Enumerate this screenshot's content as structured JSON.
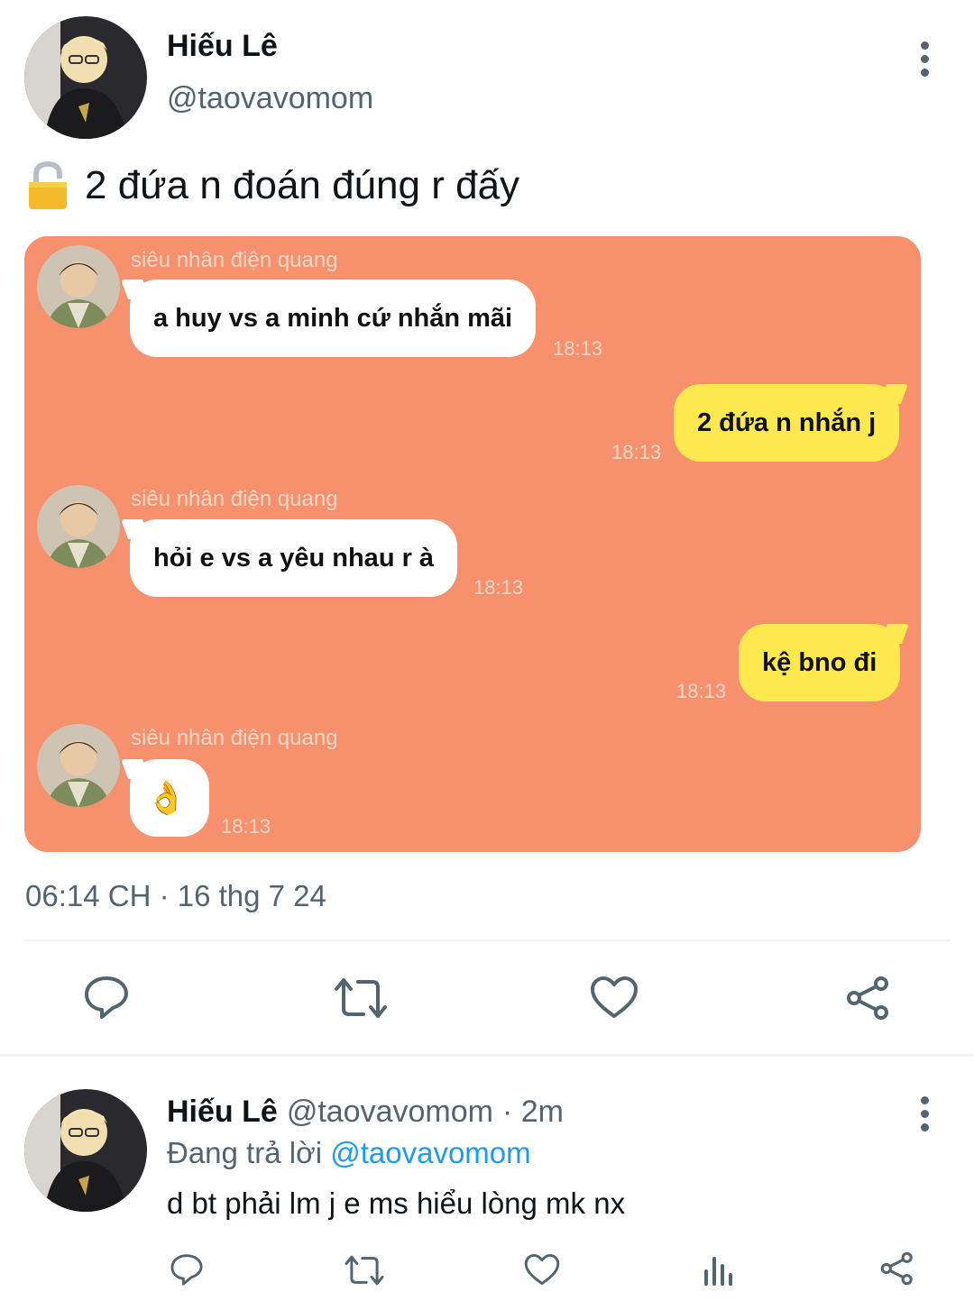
{
  "main_tweet": {
    "author_name": "Hiếu Lê",
    "author_handle": "@taovavomom",
    "text": "2 đứa n đoán đúng r đấy",
    "lock_icon": "lock-icon",
    "timestamp": "06:14 CH · 16 thg 7 24"
  },
  "chat": {
    "bg_color": "#f7916d",
    "messages": [
      {
        "sender": "siêu nhân điện quang",
        "text": "a huy vs a minh cứ nhắn mãi",
        "time": "18:13",
        "side": "left"
      },
      {
        "text": "2 đứa n nhắn j",
        "time": "18:13",
        "side": "right"
      },
      {
        "sender": "siêu nhân điện quang",
        "text": "hỏi e vs a yêu nhau r à",
        "time": "18:13",
        "side": "left"
      },
      {
        "text": "kệ bno đi",
        "time": "18:13",
        "side": "right"
      },
      {
        "sender": "siêu nhân điện quang",
        "text": "👌",
        "time": "18:13",
        "side": "left"
      }
    ]
  },
  "reply": {
    "author_name": "Hiếu Lê",
    "author_handle": "@taovavomom",
    "age": "· 2m",
    "replying_prefix": "Đang trả lời",
    "replying_to": "@taovavomom",
    "text": "d bt phải lm j e ms hiểu lòng mk nx"
  },
  "colors": {
    "accent": "#1d9bf0",
    "secondary_text": "#536471",
    "bubble_yellow": "#fde84f"
  }
}
